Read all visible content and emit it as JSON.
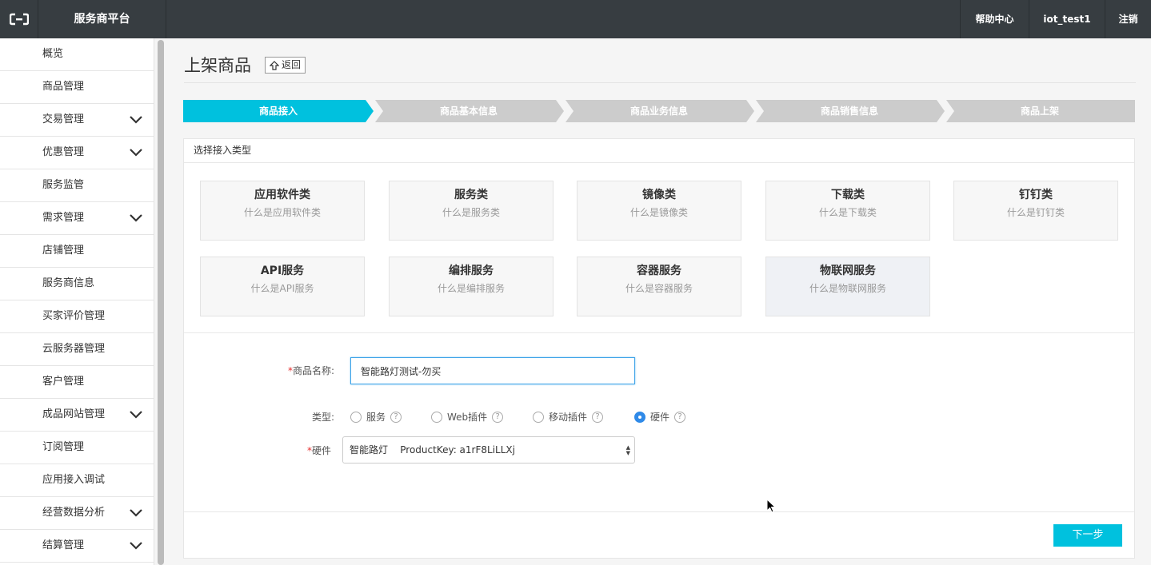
{
  "topbar": {
    "platform_title": "服务商平台",
    "links": [
      "帮助中心",
      "iot_test1",
      "注销"
    ]
  },
  "sidebar": {
    "items": [
      {
        "label": "概览",
        "expandable": false
      },
      {
        "label": "商品管理",
        "expandable": false
      },
      {
        "label": "交易管理",
        "expandable": true
      },
      {
        "label": "优惠管理",
        "expandable": true
      },
      {
        "label": "服务监管",
        "expandable": false
      },
      {
        "label": "需求管理",
        "expandable": true
      },
      {
        "label": "店铺管理",
        "expandable": false
      },
      {
        "label": "服务商信息",
        "expandable": false
      },
      {
        "label": "买家评价管理",
        "expandable": false
      },
      {
        "label": "云服务器管理",
        "expandable": false
      },
      {
        "label": "客户管理",
        "expandable": false
      },
      {
        "label": "成品网站管理",
        "expandable": true
      },
      {
        "label": "订阅管理",
        "expandable": false
      },
      {
        "label": "应用接入调试",
        "expandable": false
      },
      {
        "label": "经营数据分析",
        "expandable": true
      },
      {
        "label": "结算管理",
        "expandable": true
      }
    ]
  },
  "page": {
    "title": "上架商品",
    "back_label": "返回"
  },
  "steps": {
    "items": [
      "商品接入",
      "商品基本信息",
      "商品业务信息",
      "商品销售信息",
      "商品上架"
    ],
    "active_index": 0,
    "active_color": "#00c1de",
    "inactive_color": "#cccccc"
  },
  "access": {
    "header": "选择接入类型",
    "types": [
      {
        "name": "应用软件类",
        "sub": "什么是应用软件类"
      },
      {
        "name": "服务类",
        "sub": "什么是服务类"
      },
      {
        "name": "镜像类",
        "sub": "什么是镜像类"
      },
      {
        "name": "下载类",
        "sub": "什么是下载类"
      },
      {
        "name": "钉钉类",
        "sub": "什么是钉钉类"
      },
      {
        "name": "API服务",
        "sub": "什么是API服务"
      },
      {
        "name": "编排服务",
        "sub": "什么是编排服务"
      },
      {
        "name": "容器服务",
        "sub": "什么是容器服务"
      },
      {
        "name": "物联网服务",
        "sub": "什么是物联网服务"
      }
    ],
    "selected_index": 8
  },
  "form": {
    "name_label": "商品名称:",
    "name_value": "智能路灯测试-勿买",
    "type_label": "类型:",
    "type_options": [
      "服务",
      "Web插件",
      "移动插件",
      "硬件"
    ],
    "type_selected_index": 3,
    "hardware_label": "硬件",
    "hardware_value": "智能路灯    ProductKey: a1rF8LiLLXj",
    "required_mark": "*"
  },
  "footer": {
    "next_label": "下一步",
    "next_color": "#00c1de"
  }
}
